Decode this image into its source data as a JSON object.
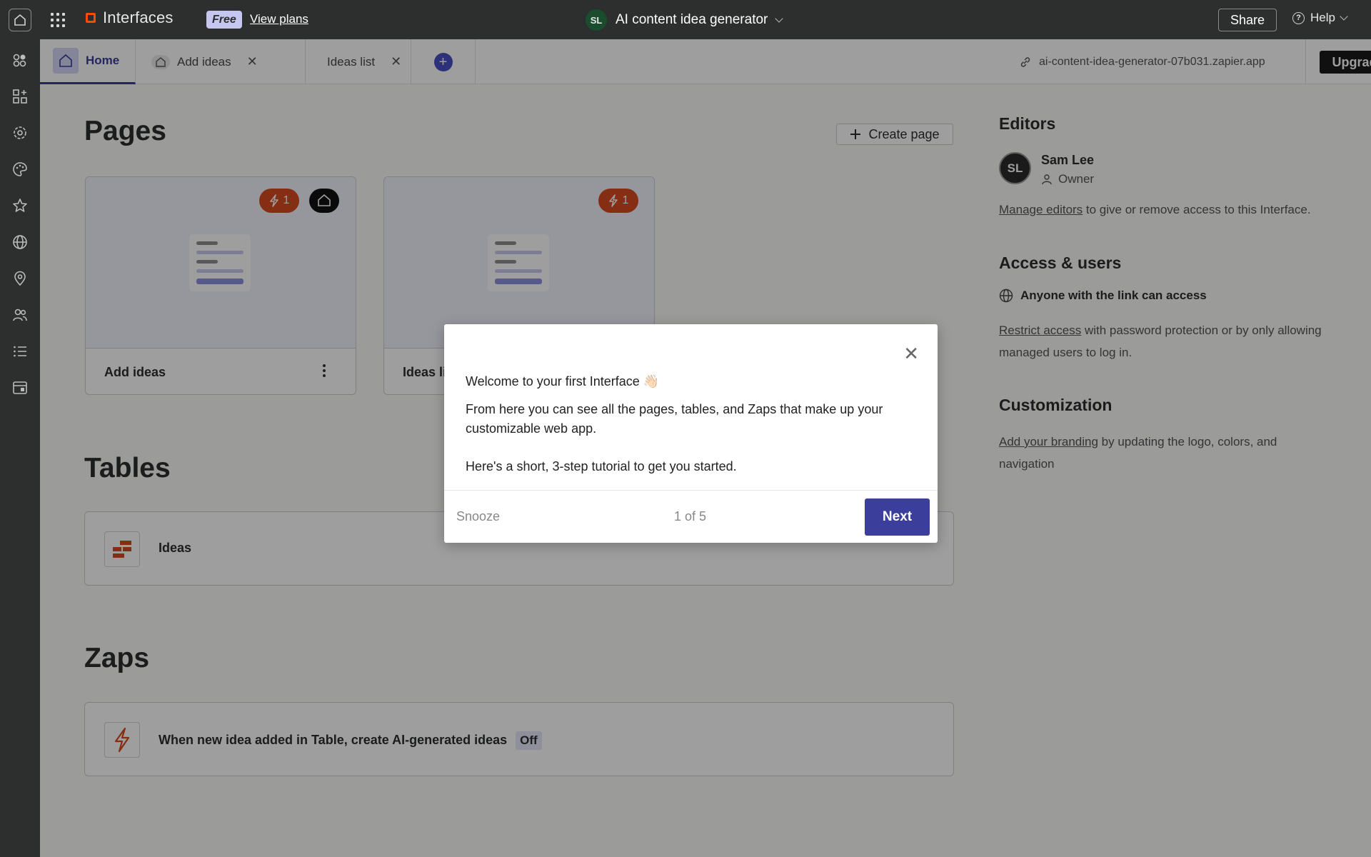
{
  "topbar": {
    "brand": "Interfaces",
    "plan_badge": "Free",
    "view_plans": "View plans",
    "app_initials": "SL",
    "app_title": "AI content idea generator",
    "share": "Share",
    "help": "Help"
  },
  "tabs": [
    {
      "label": "Home",
      "active": true
    },
    {
      "label": "Add ideas",
      "active": false
    },
    {
      "label": "Ideas list",
      "active": false
    }
  ],
  "url": "ai-content-idea-generator-07b031.zapier.app",
  "upgrade": "Upgrade",
  "pages": {
    "title": "Pages",
    "create_label": "Create page",
    "cards": [
      {
        "label": "Add ideas",
        "zap_count": "1",
        "is_home": true
      },
      {
        "label": "Ideas list",
        "zap_count": "1",
        "is_home": false
      }
    ]
  },
  "tables": {
    "title": "Tables",
    "items": [
      {
        "label": "Ideas"
      }
    ]
  },
  "zaps": {
    "title": "Zaps",
    "items": [
      {
        "label": "When new idea added in Table, create AI-generated ideas",
        "status": "Off"
      }
    ]
  },
  "editors": {
    "title": "Editors",
    "initials": "SL",
    "name": "Sam Lee",
    "role": "Owner",
    "manage_link": "Manage editors",
    "manage_text": " to give or remove access to this Interface."
  },
  "access": {
    "title": "Access & users",
    "visibility": "Anyone with the link can access",
    "restrict_link": "Restrict access",
    "restrict_text": " with password protection or by only allowing managed users to log in."
  },
  "customization": {
    "title": "Customization",
    "branding_link": "Add your branding",
    "branding_text": " by updating the logo, colors, and navigation"
  },
  "modal": {
    "heading": "Welcome to your first Interface 👋🏻",
    "body_1": "From here you can see all the pages, tables, and Zaps that make up your customizable web app.",
    "body_2": "Here's a short, 3-step tutorial to get you started.",
    "snooze": "Snooze",
    "step": "1 of 5",
    "next": "Next"
  },
  "colors": {
    "accent": "#3c3e9c",
    "zap_orange": "#d94b1f",
    "topbar": "#2d2e2e"
  }
}
